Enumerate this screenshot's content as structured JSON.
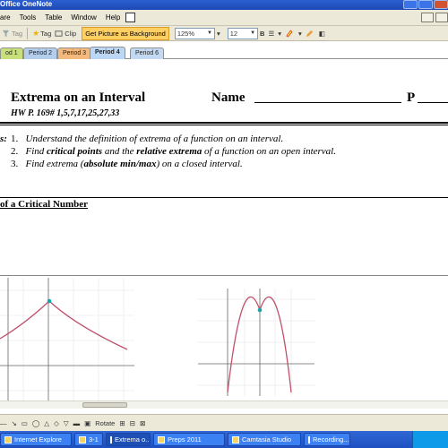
{
  "window": {
    "title": "Office OneNote"
  },
  "menu": {
    "items": [
      "are",
      "Tools",
      "Table",
      "Window",
      "Help"
    ]
  },
  "toolbar": {
    "tag_label": "Tag",
    "tag2_label": "Tag",
    "clip_label": "Clip",
    "background_button": "Get Picture as Background",
    "zoom": "125%",
    "font_size": "12",
    "bold_label": "B"
  },
  "tabs": [
    {
      "label": "od 1",
      "color": "#c7e07c"
    },
    {
      "label": "Period 2",
      "color": "#b3cdeb"
    },
    {
      "label": "Period 3",
      "color": "#f4b97d"
    },
    {
      "label": "Period 4",
      "color": "#bcd6f5",
      "active": true
    },
    {
      "label": "Period 6",
      "color": "#c2d9f1"
    }
  ],
  "page": {
    "title": "Extrema on an Interval",
    "name_label": "Name",
    "p_label": "P",
    "homework": "HW P. 169# 1,5,7,17,25,27,33",
    "objectives_prefix": "s:",
    "objectives": [
      {
        "num": "1.",
        "parts": [
          {
            "t": "Understand the definition of extrema of a function on an interval.",
            "b": false
          }
        ]
      },
      {
        "num": "2.",
        "parts": [
          {
            "t": "Find ",
            "b": false
          },
          {
            "t": "critical points",
            "b": true
          },
          {
            "t": " and the ",
            "b": false
          },
          {
            "t": "relative extrema",
            "b": true
          },
          {
            "t": " of a function on an open interval.",
            "b": false
          }
        ]
      },
      {
        "num": "3.",
        "parts": [
          {
            "t": "Find extrema (",
            "b": false
          },
          {
            "t": "absolute min/max",
            "b": true
          },
          {
            "t": ") on a closed interval.",
            "b": false
          }
        ]
      }
    ],
    "section_heading": "of a Critical Number"
  },
  "taskbar": {
    "items": [
      "Internet Explore",
      "3-1",
      "Extrema o...",
      "Preps 2011",
      "Camtasia Studio",
      "Recording..."
    ]
  },
  "drawing_toolbar": {
    "rotate_label": "Rotate"
  }
}
